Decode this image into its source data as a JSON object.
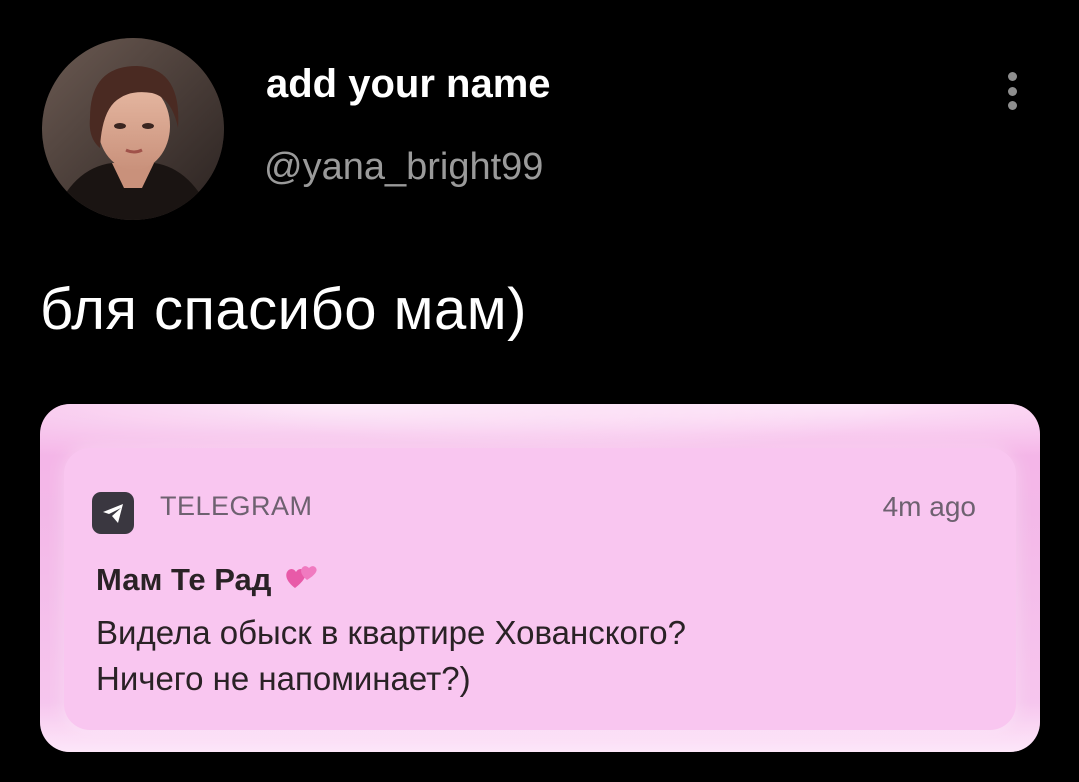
{
  "profile": {
    "display_name": "add your name",
    "handle": "@yana_bright99",
    "avatar_icon": "avatar-photo"
  },
  "post": {
    "text": "бля спасибо мам)"
  },
  "more_icon": "more-vertical-icon",
  "notification": {
    "app_name": "TELEGRAM",
    "app_icon": "telegram-icon",
    "time": "4m ago",
    "sender": "Мам Те Рад",
    "sender_emoji": "two-hearts-icon",
    "body_lines": [
      "Видела обыск в квартире Хованского?",
      "Ничего не напоминает?)"
    ]
  },
  "colors": {
    "background": "#000000",
    "notification_bg": "#f9c6f0",
    "attachment_bg": "#f3b8e8",
    "handle": "#9a9a9a"
  }
}
